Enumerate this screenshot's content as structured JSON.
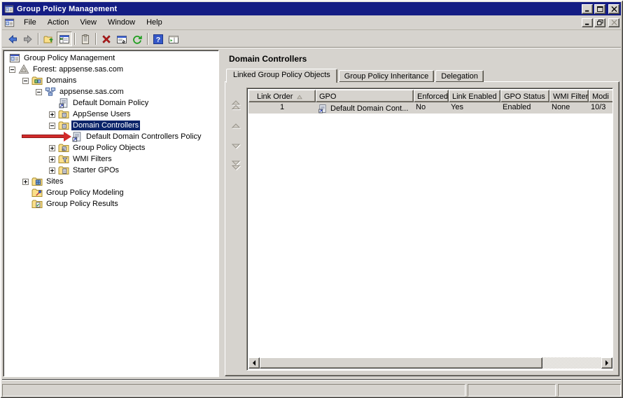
{
  "window": {
    "title": "Group Policy Management",
    "controls": [
      "minimize",
      "maximize",
      "close"
    ]
  },
  "child_window": {
    "controls": [
      "minimize",
      "restore",
      "close"
    ]
  },
  "menu_bar": {
    "items": [
      "File",
      "Action",
      "View",
      "Window",
      "Help"
    ]
  },
  "toolbar": {
    "groups": [
      [
        {
          "icon": "back-icon"
        },
        {
          "icon": "forward-icon"
        }
      ],
      [
        {
          "icon": "up-one-level-icon"
        },
        {
          "icon": "console-tree-icon",
          "toggled": true
        }
      ],
      [
        {
          "icon": "clipboard-icon"
        }
      ],
      [
        {
          "icon": "delete-icon"
        },
        {
          "icon": "properties-icon"
        },
        {
          "icon": "refresh-icon"
        }
      ],
      [
        {
          "icon": "help-icon"
        },
        {
          "icon": "action-pane-icon"
        }
      ]
    ]
  },
  "tree": {
    "items": [
      {
        "label": "Group Policy Management",
        "level": 0,
        "expander": null,
        "icon": "console-root-icon"
      },
      {
        "label": "Forest: appsense.sas.com",
        "level": 1,
        "expander": "expanded",
        "icon": "forest-icon"
      },
      {
        "label": "Domains",
        "level": 2,
        "expander": "expanded",
        "icon": "domains-folder-icon"
      },
      {
        "label": "appsense.sas.com",
        "level": 3,
        "expander": "expanded",
        "icon": "domain-icon"
      },
      {
        "label": "Default Domain Policy",
        "level": 4,
        "expander": null,
        "icon": "gpo-link-icon"
      },
      {
        "label": "AppSense Users",
        "level": 4,
        "expander": "collapsed",
        "icon": "ou-folder-icon"
      },
      {
        "label": "Domain Controllers",
        "level": 4,
        "expander": "expanded",
        "icon": "ou-folder-icon",
        "selected": true
      },
      {
        "label": "Default Domain Controllers Policy",
        "level": 5,
        "expander": null,
        "icon": "gpo-link-icon",
        "annotated": true
      },
      {
        "label": "Group Policy Objects",
        "level": 4,
        "expander": "collapsed",
        "icon": "gpo-folder-icon"
      },
      {
        "label": "WMI Filters",
        "level": 4,
        "expander": "collapsed",
        "icon": "wmi-folder-icon"
      },
      {
        "label": "Starter GPOs",
        "level": 4,
        "expander": "collapsed",
        "icon": "starter-folder-icon"
      },
      {
        "label": "Sites",
        "level": 2,
        "expander": "collapsed",
        "icon": "sites-folder-icon"
      },
      {
        "label": "Group Policy Modeling",
        "level": 2,
        "expander": null,
        "icon": "modeling-icon"
      },
      {
        "label": "Group Policy Results",
        "level": 2,
        "expander": null,
        "icon": "results-icon"
      }
    ],
    "annotation_arrow_target": "Default Domain Controllers Policy"
  },
  "content": {
    "title": "Domain Controllers",
    "tabs": [
      {
        "label": "Linked Group Policy Objects",
        "active": true
      },
      {
        "label": "Group Policy Inheritance",
        "active": false
      },
      {
        "label": "Delegation",
        "active": false
      }
    ],
    "link_order_buttons": [
      "move-top-icon",
      "move-up-icon",
      "move-down-icon",
      "move-bottom-icon"
    ],
    "table": {
      "columns": [
        "Link Order",
        "GPO",
        "Enforced",
        "Link Enabled",
        "GPO Status",
        "WMI Filter",
        "Modi"
      ],
      "sort_column": "Link Order",
      "rows": [
        {
          "icon": "gpo-link-icon",
          "link_order": "1",
          "gpo": "Default Domain Cont...",
          "enforced": "No",
          "link_enabled": "Yes",
          "gpo_status": "Enabled",
          "wmi_filter": "None",
          "modified": "10/3"
        }
      ]
    }
  },
  "status_bar": {
    "panels": [
      "",
      "",
      ""
    ]
  },
  "colors": {
    "title_bar": "#141D84",
    "selection": "#0A246A",
    "chrome": "#D6D3CE",
    "annotation_arrow": "#D22B2B"
  }
}
